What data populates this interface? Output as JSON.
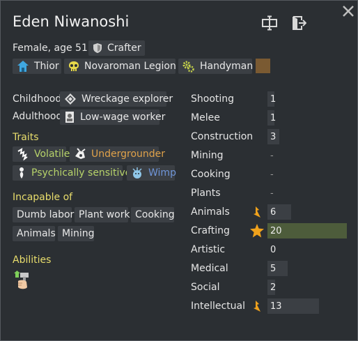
{
  "pawn": {
    "name": "Eden Niwanoshi",
    "gender_age": "Female, age 51",
    "role": {
      "label": "Crafter",
      "icon": "shield-icon"
    }
  },
  "factions": [
    {
      "label": "Thior",
      "icon": "house-icon",
      "color": "#3fa7e0"
    },
    {
      "label": "Novaroman Legion",
      "icon": "skull-icon",
      "color": "#e6d84a"
    },
    {
      "label": "Handyman",
      "icon": "gears-icon",
      "color": "#c5d24a"
    }
  ],
  "favorite_color": "#7a5a32",
  "backstory": {
    "childhood_label": "Childhood",
    "childhood_value": "Wreckage explorer",
    "adulthood_label": "Adulthood",
    "adulthood_value": "Low-wage worker"
  },
  "traits": {
    "title": "Traits",
    "items": [
      {
        "label": "Volatile",
        "color": "#b7d36a",
        "icon": "lightning-icon"
      },
      {
        "label": "Undergrounder",
        "color": "#e0a24a",
        "icon": "miner-icon"
      },
      {
        "label": "Psychically sensitive",
        "color": "#b7d36a",
        "icon": "psychic-icon"
      },
      {
        "label": "Wimp",
        "color": "#6f95d8",
        "icon": "wimp-icon"
      }
    ]
  },
  "incapable": {
    "title": "Incapable of",
    "items": [
      "Dumb labor",
      "Plant work",
      "Cooking",
      "Animals",
      "Mining"
    ]
  },
  "abilities": {
    "title": "Abilities",
    "icon": "ability-icon"
  },
  "skills": [
    {
      "name": "Shooting",
      "level": "1",
      "fill": 1,
      "passion": "none"
    },
    {
      "name": "Melee",
      "level": "1",
      "fill": 1,
      "passion": "none"
    },
    {
      "name": "Construction",
      "level": "3",
      "fill": 3,
      "passion": "none"
    },
    {
      "name": "Mining",
      "level": "-",
      "fill": 0,
      "passion": "none"
    },
    {
      "name": "Cooking",
      "level": "-",
      "fill": 0,
      "passion": "none"
    },
    {
      "name": "Plants",
      "level": "-",
      "fill": 0,
      "passion": "none"
    },
    {
      "name": "Animals",
      "level": "6",
      "fill": 6,
      "passion": "minor"
    },
    {
      "name": "Crafting",
      "level": "20",
      "fill": 20,
      "passion": "major"
    },
    {
      "name": "Artistic",
      "level": "0",
      "fill": 0,
      "passion": "none"
    },
    {
      "name": "Medical",
      "level": "5",
      "fill": 5,
      "passion": "none"
    },
    {
      "name": "Social",
      "level": "2",
      "fill": 2,
      "passion": "none"
    },
    {
      "name": "Intellectual",
      "level": "13",
      "fill": 13,
      "passion": "minor"
    }
  ],
  "skill_max": 20,
  "colors": {
    "section": "#e8dd6c",
    "major_skill_bar": "#4d5c3b",
    "normal_skill_bar": "#3b3f44",
    "flame": "#f0a21c"
  }
}
